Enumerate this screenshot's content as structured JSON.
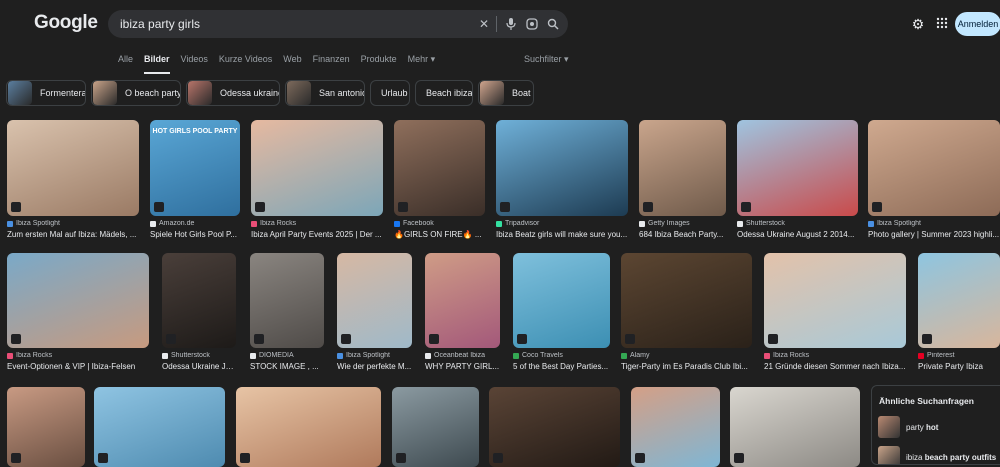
{
  "logo": "Google",
  "search": {
    "value": "ibiza party girls",
    "icons": [
      "close-icon",
      "microphone-icon",
      "lens-icon",
      "search-icon"
    ]
  },
  "header": {
    "settings_icon": "gear-icon",
    "apps_icon": "apps-grid-icon",
    "signin": "Anmelden"
  },
  "tabs": [
    "Alle",
    "Bilder",
    "Videos",
    "Kurze Videos",
    "Web",
    "Finanzen",
    "Produkte",
    "Mehr ▾"
  ],
  "active_tab": "Bilder",
  "filter": "Suchfilter ▾",
  "chips": [
    {
      "label": "Formentera",
      "thumb": true,
      "color": "#5b7fa0"
    },
    {
      "label": "O beach party",
      "thumb": true,
      "color": "#c9a48a"
    },
    {
      "label": "Odessa ukraine",
      "thumb": true,
      "color": "#b8756a"
    },
    {
      "label": "San antonio",
      "thumb": true,
      "color": "#7d6a5c"
    },
    {
      "label": "Urlaub",
      "thumb": false
    },
    {
      "label": "Beach ibiza",
      "thumb": false
    },
    {
      "label": "Boat",
      "thumb": true,
      "color": "#d0a58e"
    }
  ],
  "results_row1": [
    {
      "source": "Ibiza Spotlight",
      "title": "Zum ersten Mal auf Ibiza: Mädels, ...",
      "colors": [
        "#d9c2ad",
        "#9a7a64"
      ],
      "fav": "#4a90e2"
    },
    {
      "source": "Amazon.de",
      "title": "Spiele Hot Girls Pool P...",
      "colors": [
        "#5aa7d6",
        "#2f6f9e"
      ],
      "fav": "#e8eaed",
      "overlay": "HOT GIRLS POOL PARTY"
    },
    {
      "source": "Ibiza Rocks",
      "title": "Ibiza April Party Events 2025 | Der ...",
      "colors": [
        "#e6b9a0",
        "#7ca6b8"
      ],
      "fav": "#e94e77"
    },
    {
      "source": "Facebook",
      "title": "🔥GIRLS ON FIRE🔥 ...",
      "colors": [
        "#8f6f5c",
        "#3a2e28"
      ],
      "fav": "#1877f2"
    },
    {
      "source": "Tripadvisor",
      "title": "Ibiza Beatz girls will make sure you...",
      "colors": [
        "#6fb0d8",
        "#1d3b52"
      ],
      "fav": "#34e0a1"
    },
    {
      "source": "Getty Images",
      "title": "684 Ibiza Beach Party...",
      "colors": [
        "#c9a58c",
        "#6f5a4a"
      ],
      "fav": "#e8eaed"
    },
    {
      "source": "Shutterstock",
      "title": "Odessa Ukraine August 2 2014...",
      "colors": [
        "#9fc4e0",
        "#c94a4a"
      ],
      "fav": "#e8eaed"
    },
    {
      "source": "Ibiza Spotlight",
      "title": "Photo gallery | Summer 2023 highli...",
      "colors": [
        "#cfa98f",
        "#8d6b57"
      ],
      "fav": "#4a90e2"
    }
  ],
  "results_row2": [
    {
      "source": "Ibiza Rocks",
      "title": "Event-Optionen & VIP | Ibiza-Felsen",
      "colors": [
        "#7aa9c8",
        "#c79a7f"
      ],
      "fav": "#e94e77"
    },
    {
      "source": "Shutterstock",
      "title": "Odessa Ukraine Ju...",
      "colors": [
        "#4a3f3a",
        "#1d1a18"
      ],
      "fav": "#e8eaed"
    },
    {
      "source": "DIOMEDIA",
      "title": "STOCK IMAGE , ...",
      "colors": [
        "#8a8580",
        "#4f4b48"
      ],
      "fav": "#e8eaed"
    },
    {
      "source": "Ibiza Spotlight",
      "title": "Wie der perfekte M...",
      "colors": [
        "#d6b8a3",
        "#9fb9c9"
      ],
      "fav": "#4a90e2"
    },
    {
      "source": "Oceanbeat Ibiza",
      "title": "WHY PARTY GIRL...",
      "colors": [
        "#cf9c86",
        "#a3587a"
      ],
      "fav": "#e8eaed"
    },
    {
      "source": "Coco Travels",
      "title": "5 of the Best Day Parties...",
      "colors": [
        "#7fc0dc",
        "#3c8fb3"
      ],
      "fav": "#34a853"
    },
    {
      "source": "Alamy",
      "title": "Tiger-Party im Es Paradis Club Ibi...",
      "colors": [
        "#5c4632",
        "#2a2119"
      ],
      "fav": "#34a853"
    },
    {
      "source": "Ibiza Rocks",
      "title": "21 Gründe diesen Sommer nach Ibiza...",
      "colors": [
        "#e3c2aa",
        "#a8c9d8"
      ],
      "fav": "#e94e77"
    },
    {
      "source": "Pinterest",
      "title": "Private Party Ibiza",
      "colors": [
        "#8ec5e0",
        "#d8b69c"
      ],
      "fav": "#e60023"
    }
  ],
  "results_row3": [
    {
      "colors": [
        "#c89a83",
        "#6a4f41"
      ]
    },
    {
      "colors": [
        "#8fc4e2",
        "#4e8bb0"
      ]
    },
    {
      "colors": [
        "#e7c4a5",
        "#b07a5c"
      ]
    },
    {
      "colors": [
        "#8b9aa1",
        "#3e4a50"
      ]
    },
    {
      "colors": [
        "#5a4436",
        "#221a15"
      ]
    },
    {
      "colors": [
        "#d49f86",
        "#7fb6d4"
      ]
    },
    {
      "colors": [
        "#d9d6cf",
        "#8d8a85"
      ]
    }
  ],
  "related": {
    "title": "Ähnliche Suchanfragen",
    "items": [
      {
        "prefix": "party ",
        "bold": "hot",
        "color": "#b98a72"
      },
      {
        "prefix": "ibiza ",
        "bold": "beach party outfits",
        "color": "#c9a48a"
      }
    ]
  }
}
